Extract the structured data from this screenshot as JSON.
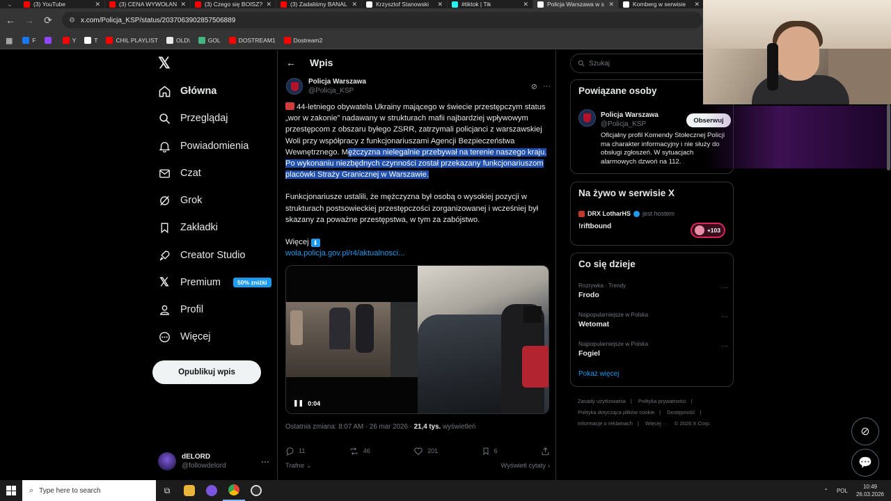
{
  "browser": {
    "tabs": [
      {
        "label": "(3) YouTube",
        "color": "#ff0000",
        "active": false
      },
      {
        "label": "(3) CENA WYWOŁAN",
        "color": "#ff0000",
        "active": false
      },
      {
        "label": "(3) Czego się BOISZ?",
        "color": "#ff0000",
        "active": false
      },
      {
        "label": "(3) Zadaliśmy BANAL",
        "color": "#ff0000",
        "active": false
      },
      {
        "label": "Krzysztof Stanowski",
        "color": "#ffffff",
        "active": false
      },
      {
        "label": "#tiktok | Tik",
        "color": "#25f4ee",
        "active": false
      },
      {
        "label": "Policja Warszawa w s",
        "color": "#ffffff",
        "active": true
      },
      {
        "label": "Komberg w serwisie",
        "color": "#ffffff",
        "active": false
      }
    ],
    "url": "x.com/Policja_KSP/status/2037063902857506889",
    "bookmarks": [
      {
        "label": "F",
        "color": "#1877f2"
      },
      {
        "label": "",
        "color": "#9146ff"
      },
      {
        "label": "Y",
        "color": "#ff0000"
      },
      {
        "label": "T",
        "color": "#ffffff"
      },
      {
        "label": "CHIL PLAYLIST",
        "color": "#ff0000"
      },
      {
        "label": "OLD\\",
        "color": "#e8e8e8"
      },
      {
        "label": "GOL",
        "color": "#43b581"
      },
      {
        "label": "DOSTREAM1",
        "color": "#ff0000"
      },
      {
        "label": "Dostream2",
        "color": "#ff0000"
      }
    ]
  },
  "nav": {
    "items": [
      {
        "label": "Główna",
        "icon": "home-icon"
      },
      {
        "label": "Przeglądaj",
        "icon": "search-icon"
      },
      {
        "label": "Powiadomienia",
        "icon": "bell-icon"
      },
      {
        "label": "Czat",
        "icon": "mail-icon"
      },
      {
        "label": "Grok",
        "icon": "grok-icon"
      },
      {
        "label": "Zakładki",
        "icon": "bookmark-icon"
      },
      {
        "label": "Creator Studio",
        "icon": "rocket-icon"
      },
      {
        "label": "Premium",
        "icon": "x-icon"
      },
      {
        "label": "Profil",
        "icon": "person-icon"
      },
      {
        "label": "Więcej",
        "icon": "more-circle-icon"
      }
    ],
    "premium_badge": "50% zniżki",
    "post_button": "Opublikuj wpis",
    "account": {
      "name": "dELORD",
      "handle": "@followdelord"
    }
  },
  "post": {
    "header_title": "Wpis",
    "author_name": "Policja Warszawa",
    "author_handle": "@Policja_KSP",
    "text_part1": "44-letniego obywatela Ukrainy mającego w świecie przestępczym status „wor w zakonie” nadawany w strukturach mafii najbardziej wpływowym przestępcom z obszaru byłego ZSRR, zatrzymali policjanci z warszawskiej Woli przy współpracy z funkcjonariuszami Agencji Bezpieczeństwa Wewnętrznego. M",
    "text_part1_selected": "ężczyzna nielegalnie przebywał na terenie naszego kraju. Po wykonaniu niezbędnych czynności został przekazany funkcjonariuszom placówki Straży Granicznej w Warszawie.",
    "text_part2": "Funkcjonariusze ustalili, że mężczyzna był osobą o wysokiej pozycji w strukturach postsowieckiej przestępczości zorganizowanej i wcześniej był skazany za poważne przestępstwa, w tym za zabójstwo.",
    "more_label": "Więcej",
    "link": "wola.policja.gov.pl/r4/aktualnosci...",
    "video_time": "0:04",
    "meta_prefix": "Ostatnia zmiana: 8:07 AM · 26 mar 2026 · ",
    "views_count": "21,4 tys.",
    "views_label": " wyświetleń",
    "stats": {
      "replies": "11",
      "reposts": "46",
      "likes": "201",
      "bookmarks": "6"
    },
    "sort_label": "Trafne",
    "quotes_label": "Wyświetl cytaty"
  },
  "sidebar": {
    "search_placeholder": "Szukaj",
    "related_title": "Powiązane osoby",
    "related": {
      "name": "Policja Warszawa",
      "handle": "@Policja_KSP",
      "follow": "Obserwuj",
      "bio": "Oficjalny profil Komendy Stołecznej Policji ma charakter informacyjny i nie służy do obsługi zgłoszeń. W sytuacjach alarmowych dzwoń na 112."
    },
    "live_title": "Na żywo w serwisie X",
    "live": {
      "host": "DRX LotharHS",
      "host_suffix": "jest hostem",
      "title": "!riftbound",
      "count": "+103"
    },
    "trends_title": "Co się dzieje",
    "trends": [
      {
        "category": "Rozrywka · Trendy",
        "name": "Frodo"
      },
      {
        "category": "Najpopularniejsze w Polska",
        "name": "Wetomat"
      },
      {
        "category": "Najpopularniejsze w Polska",
        "name": "Fogiel"
      }
    ],
    "show_more": "Pokaż więcej",
    "footer": [
      "Zasady użytkowania",
      "Polityka prywatności",
      "Polityka dotycząca plików cookie",
      "Dostępność",
      "Informacje o reklamach",
      "Więcej ···",
      "© 2026 X Corp."
    ]
  },
  "taskbar": {
    "search_placeholder": "Type here to search",
    "lang": "POL",
    "time": "10:49",
    "date": "26.03.2026"
  }
}
